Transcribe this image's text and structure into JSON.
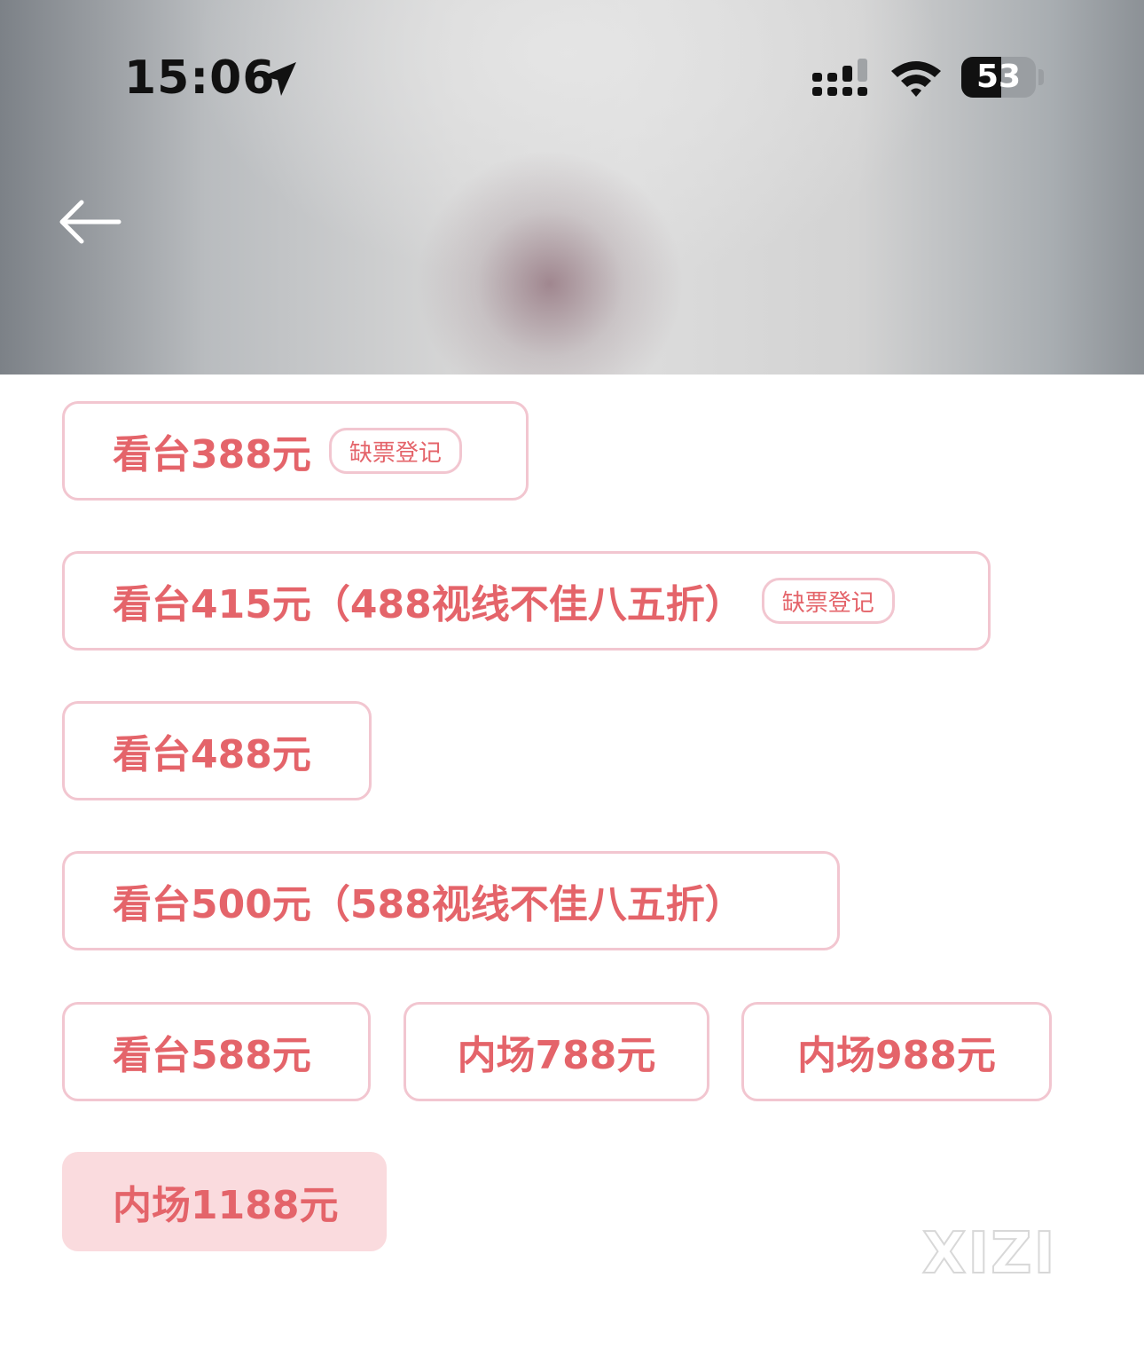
{
  "status_bar": {
    "time": "15:06",
    "battery": "53",
    "battery_level": 0.53
  },
  "options": [
    {
      "label": "看台388元",
      "tag": "缺票登记"
    },
    {
      "label": "看台415元（488视线不佳八五折）",
      "tag": "缺票登记"
    },
    {
      "label": "看台488元"
    },
    {
      "label": "看台500元（588视线不佳八五折）"
    },
    {
      "label": "看台588元"
    },
    {
      "label": "内场788元"
    },
    {
      "label": "内场988元"
    },
    {
      "label": "内场1188元",
      "selected": true
    }
  ],
  "watermark": "XIZI",
  "colors": {
    "accent_text": "#e4646a",
    "option_border": "#f2c6d0",
    "selected_bg": "#fadbde"
  }
}
